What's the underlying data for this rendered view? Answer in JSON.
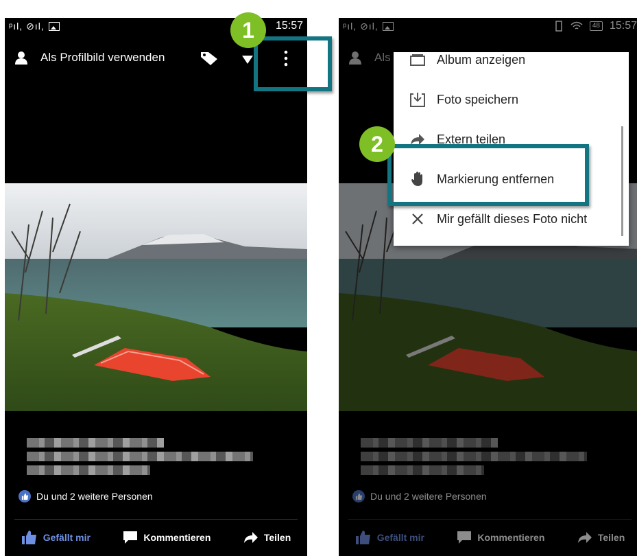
{
  "left_screen": {
    "status": {
      "signal_text": "ᵖıl, ⊘ıl,",
      "time": "15:57"
    },
    "appbar": {
      "title": "Als Profilbild verwenden"
    },
    "likes": "Du und 2 weitere Personen",
    "actions": {
      "like": "Gefällt mir",
      "comment": "Kommentieren",
      "share": "Teilen"
    },
    "step_badge": "1"
  },
  "right_screen": {
    "status": {
      "signal_text": "ᵖıl, ⊘ıl,",
      "battery": "48",
      "time": "15:57"
    },
    "appbar": {
      "title_partial": "Als"
    },
    "menu": {
      "items": [
        {
          "label": "Album anzeigen",
          "icon": "album-icon"
        },
        {
          "label": "Foto speichern",
          "icon": "download-icon"
        },
        {
          "label": "Extern teilen",
          "icon": "share-arrow-icon"
        },
        {
          "label": "Markierung entfernen",
          "icon": "hand-icon"
        },
        {
          "label": "Mir gefällt dieses Foto nicht",
          "icon": "close-icon"
        }
      ]
    },
    "likes": "Du und 2 weitere Personen",
    "actions": {
      "like": "Gefällt mir",
      "comment": "Kommentieren",
      "share": "Teilen"
    },
    "step_badge": "2"
  },
  "colors": {
    "highlight_box": "#137482",
    "step_badge": "#7fbf26",
    "like_blue": "#6f8fe2"
  }
}
